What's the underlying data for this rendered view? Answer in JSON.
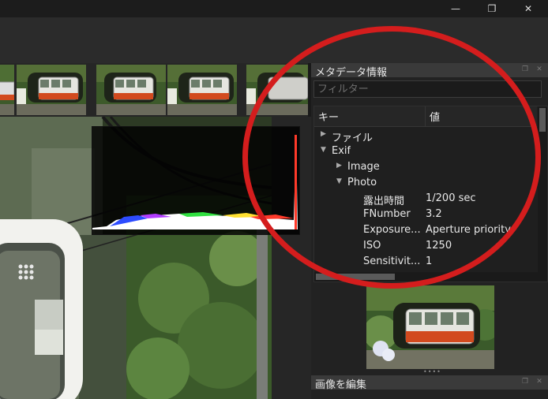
{
  "window": {
    "minimize_glyph": "—",
    "maximize_glyph": "❐",
    "close_glyph": "✕"
  },
  "metadata_panel": {
    "title": "メタデータ情報",
    "filter_placeholder": "フィルター",
    "columns": {
      "key": "キー",
      "value": "値"
    },
    "rows": [
      {
        "key": "ファイル",
        "value": "",
        "level": 0,
        "expanded": false
      },
      {
        "key": "Exif",
        "value": "",
        "level": 0,
        "expanded": true
      },
      {
        "key": "Image",
        "value": "",
        "level": 1,
        "expanded": false
      },
      {
        "key": "Photo",
        "value": "",
        "level": 1,
        "expanded": true
      },
      {
        "key": "露出時間",
        "value": "1/200 sec",
        "level": 2
      },
      {
        "key": "FNumber",
        "value": "3.2",
        "level": 2
      },
      {
        "key": "Exposure...",
        "value": "Aperture priority",
        "level": 2
      },
      {
        "key": "ISO",
        "value": "1250",
        "level": 2
      },
      {
        "key": "Sensitivit...",
        "value": "1",
        "level": 2
      }
    ]
  },
  "edit_panel": {
    "title": "画像を編集"
  },
  "filmstrip": {
    "count": 4
  },
  "colors": {
    "annotation_circle": "#d41d1d",
    "panel_header": "#3a3a3a"
  }
}
